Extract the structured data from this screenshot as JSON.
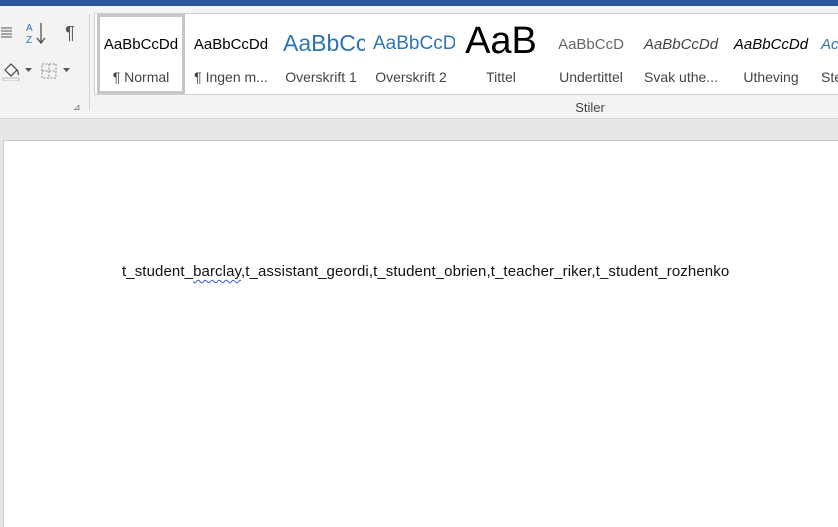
{
  "ribbon": {
    "paragraph_tools": {
      "list_icon": "list-icon",
      "sort_icon": "sort-az-icon",
      "pilcrow": "¶",
      "shading_icon": "paint-bucket-icon",
      "borders_icon": "borders-icon",
      "launcher_glyph": "⊿"
    },
    "styles_group_label": "Stiler",
    "styles": [
      {
        "preview": "AaBbCcDd",
        "label": "¶ Normal",
        "selected": true
      },
      {
        "preview": "AaBbCcDd",
        "label": "¶ Ingen m..."
      },
      {
        "preview": "AaBbCc",
        "label": "Overskrift 1"
      },
      {
        "preview": "AaBbCcD",
        "label": "Overskrift 2"
      },
      {
        "preview": "AaB",
        "label": "Tittel"
      },
      {
        "preview": "AaBbCcD",
        "label": "Undertittel"
      },
      {
        "preview": "AaBbCcDd",
        "label": "Svak uthe..."
      },
      {
        "preview": "AaBbCcDd",
        "label": "Utheving"
      },
      {
        "preview": "Ac",
        "label": "Ste"
      }
    ]
  },
  "document": {
    "text_before": "t_student_",
    "misspelled": "barclay",
    "text_after": ",t_assistant_geordi,t_student_obrien,t_teacher_riker,t_student_rozhenko"
  },
  "colors": {
    "title_bar": "#2b579a",
    "heading_blue": "#2e74b5",
    "spell_underline": "#3a55d6"
  }
}
